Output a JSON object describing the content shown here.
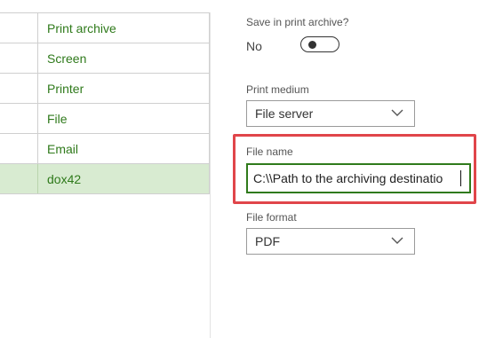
{
  "print_destinations": {
    "items": [
      {
        "label": "Print archive"
      },
      {
        "label": "Screen"
      },
      {
        "label": "Printer"
      },
      {
        "label": "File"
      },
      {
        "label": "Email"
      },
      {
        "label": "dox42",
        "selected": true
      }
    ]
  },
  "settings": {
    "save_in_archive": {
      "label": "Save in print archive?",
      "state_text": "No",
      "value": false
    },
    "print_medium": {
      "label": "Print medium",
      "value": "File server"
    },
    "file_name": {
      "label": "File name",
      "value": "C:\\\\Path to the archiving destinatio"
    },
    "file_format": {
      "label": "File format",
      "value": "PDF"
    }
  },
  "colors": {
    "accent_green": "#2f7a1b",
    "selected_row_bg": "#d8ebd1",
    "highlight_red": "#e0454a"
  }
}
